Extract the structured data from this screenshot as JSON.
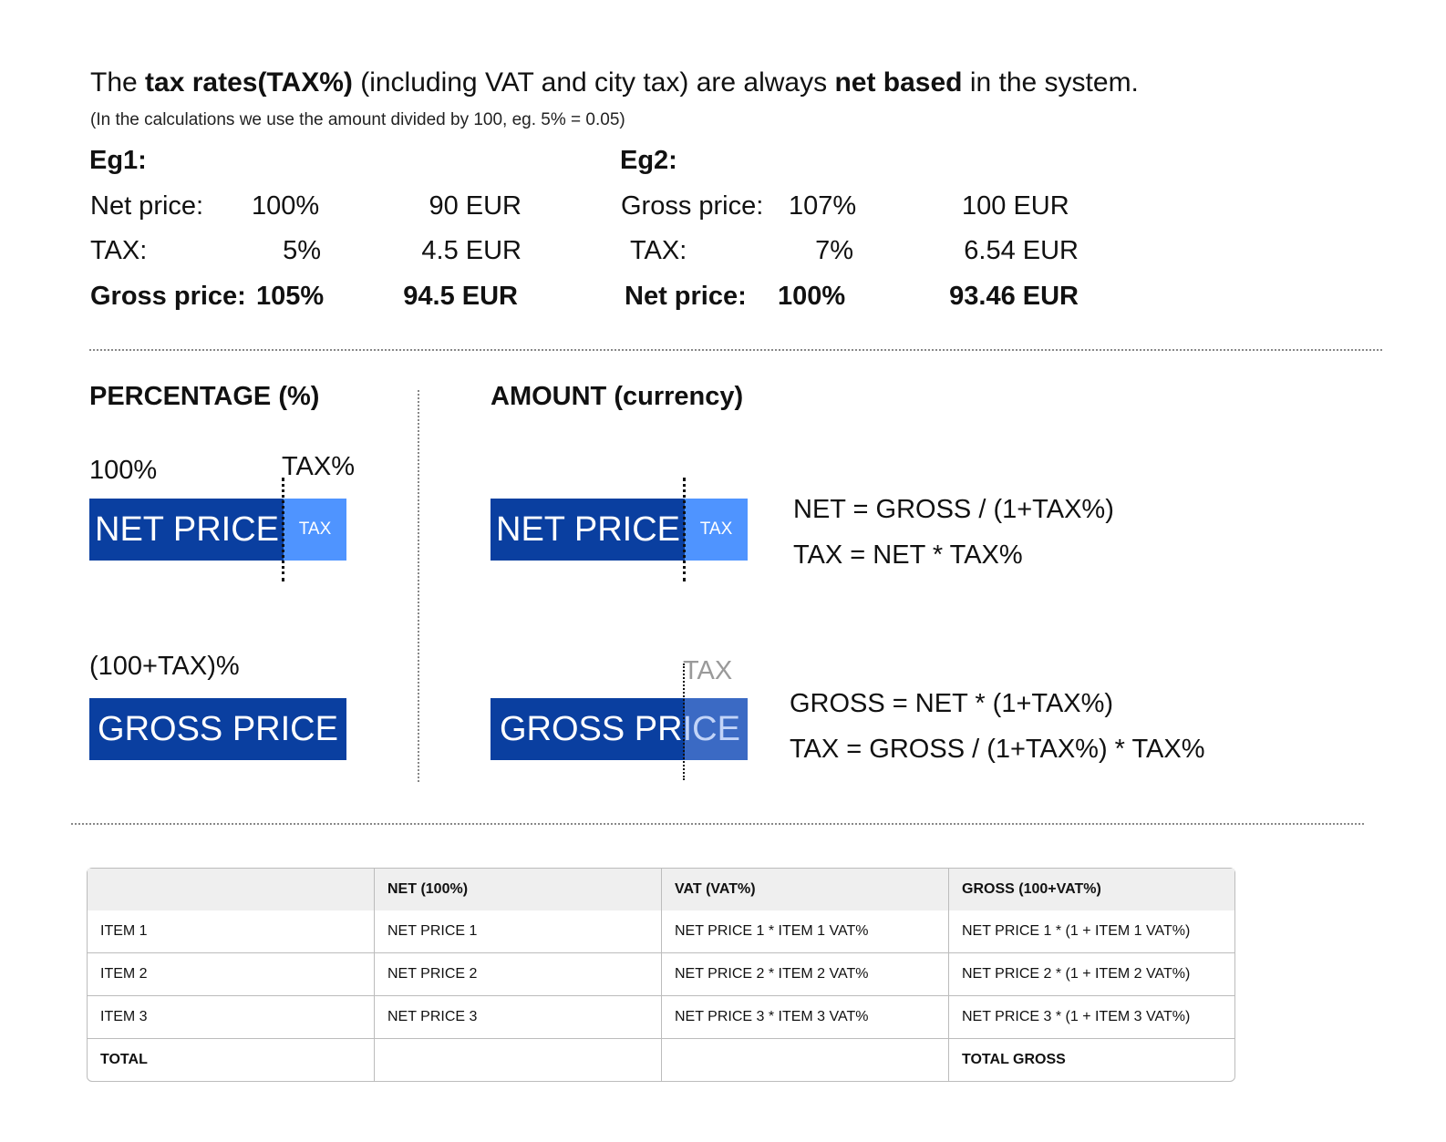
{
  "intro": {
    "p1": "The ",
    "b1": "tax rates(TAX%)",
    "p2": " (including VAT and city tax) are always ",
    "b2": "net based",
    "p3": " in the system.",
    "note": "(In the calculations we use the amount divided by 100, eg. 5% = 0.05)"
  },
  "eg1": {
    "title": "Eg1:",
    "rows": [
      {
        "label": "Net price:",
        "pct": "100%",
        "amount": "90 EUR"
      },
      {
        "label": "TAX:",
        "pct": "5%",
        "amount": "4.5 EUR"
      },
      {
        "label": "Gross price:",
        "pct": "105%",
        "amount": "94.5 EUR"
      }
    ]
  },
  "eg2": {
    "title": "Eg2:",
    "rows": [
      {
        "label": "Gross price:",
        "pct": "107%",
        "amount": "100 EUR"
      },
      {
        "label": "TAX:",
        "pct": "7%",
        "amount": "6.54 EUR"
      },
      {
        "label": "Net price:",
        "pct": "100%",
        "amount": "93.46 EUR"
      }
    ]
  },
  "percentage": {
    "title": "PERCENTAGE (%)",
    "label_100": "100%",
    "label_taxpct": "TAX%",
    "net_bar": "NET PRICE",
    "tax_box": "TAX",
    "label_gross": "(100+TAX)%",
    "gross_bar": "GROSS PRICE"
  },
  "amount": {
    "title": "AMOUNT (currency)",
    "net_bar": "NET PRICE",
    "tax_box": "TAX",
    "formula_net": "NET = GROSS / (1+TAX%)",
    "formula_tax1": "TAX = NET * TAX%",
    "tax_label": "TAX",
    "gross_bar": "GROSS PRICE",
    "formula_gross": "GROSS = NET * (1+TAX%)",
    "formula_tax2": "TAX = GROSS / (1+TAX%) * TAX%"
  },
  "table": {
    "headers": [
      "",
      "NET (100%)",
      "VAT (VAT%)",
      "GROSS (100+VAT%)"
    ],
    "rows": [
      [
        "ITEM 1",
        "NET PRICE 1",
        "NET PRICE 1 * ITEM 1 VAT%",
        "NET PRICE 1 * (1 + ITEM 1 VAT%)"
      ],
      [
        "ITEM 2",
        "NET PRICE 2",
        "NET PRICE 2 * ITEM 2 VAT%",
        "NET PRICE 2 * (1 + ITEM 2 VAT%)"
      ],
      [
        "ITEM 3",
        "NET PRICE 3",
        "NET PRICE 3 * ITEM 3 VAT%",
        "NET PRICE 3 * (1 + ITEM 3 VAT%)"
      ],
      [
        "TOTAL",
        "",
        "",
        "TOTAL GROSS"
      ]
    ]
  }
}
